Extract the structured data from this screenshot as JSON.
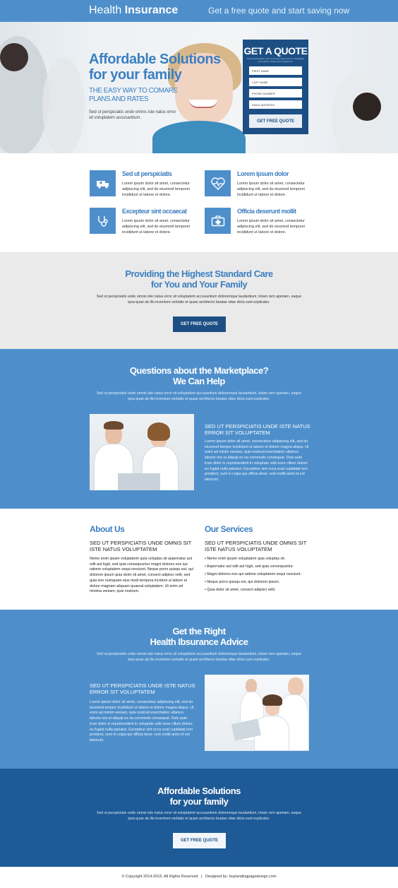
{
  "header": {
    "logo_light": "Health ",
    "logo_bold": "Insurance",
    "tagline": "Get a free quote and start saving now"
  },
  "hero": {
    "title": "Affordable Solutions for your family",
    "subtitle": "THE EASY WAY TO COMARE PLANS AND RATES",
    "description": "Sed ut perspiciatis unde omnis iste natus error sit voluptatem accusantium."
  },
  "quote_form": {
    "title": "GET A QUOTE",
    "subtitle": "Sed ut perspiciatis unde omnis iste natus error sit voluptatem accusantium doloremque laudantium",
    "first_name_placeholder": "FIRST NAME",
    "last_name_placeholder": "LAST NAME",
    "phone_placeholder": "PHONE NUMBER",
    "email_placeholder": "EMAIL ADDRESS",
    "button": "GET FREE QUOTE"
  },
  "features": [
    {
      "title": "Sed ut perspiciatis",
      "text": "Lorem ipsum dolor sit amet, consectetur adipiscing elit, sed do eiusmod temporei incididunt ut labore et dolore.",
      "icon": "ambulance-icon"
    },
    {
      "title": "Lorem ipsum dolor",
      "text": "Lorem ipsum dolor sit amet, consectetur adipiscing elit, sed do eiusmod temporei incididunt ut labore et dolore.",
      "icon": "heartbeat-icon"
    },
    {
      "title": "Excepteur sint occaecat",
      "text": "Lorem ipsum dolor sit amet, consectetur adipiscing elit, sed do eiusmod temporei incididunt ut labore et dolore.",
      "icon": "stethoscope-icon"
    },
    {
      "title": "Officia deserunt mollit",
      "text": "Lorem ipsum dolor sit amet, consectetur adipiscing elit, sed do eiusmod temporei incididunt ut labore et dolore.",
      "icon": "medical-kit-icon"
    }
  ],
  "standard_care": {
    "title_line1": "Providing the Highest Standard Care",
    "title_line2": "for You and Your Family",
    "description": "Sed ut perspiciatis unde omnis iste natus error sit voluptatem accusantium doloremque laudantium, totam rem aperiam, eaque ipsa quae ab illo inventore veritatis et quasi architecto beatae vitae dicta sunt explicabo.",
    "button": "GET FREE QUOTE"
  },
  "marketplace": {
    "title_line1": "Questions about the Marketplace?",
    "title_line2": "We Can Help",
    "description": "Sed ut perspiciatis unde omnis iste natus error sit voluptatem accusantium doloremque laudantium, totam rem aperiam, eaque ipsa quae ab illo inventore veritatis et quasi architecto beatae vitae dicta sunt explicabo.",
    "caption_title": "SED UT PERSPICIATIS UNDE ISTE NATUS ERROR SIT VOLUPTATEM",
    "caption_text": "Lorem ipsum dolor sit amet, consectetur adipiscing elit, sed do eiusmod tempor incididunt ut labore et dolore magna aliqua. Ut enim ad minim veniam, quis nostrud exercitation ullamco laboris nisi ut aliquip ex ea commodo consequat. Duis aute irure dolor in reprehenderit in voluptate velit esse cillum dolore eu fugiat nulla pariatur. Excepteur sint occa ecat cupidatat non proident, sunt in culpa qui officia dese- runt mollit anim id est laborum."
  },
  "about": {
    "title": "About Us",
    "subtitle": "SED UT PERSPICIATIS UNDE OMNIS SIT ISTE NATUS  VOLUPTATEM",
    "text": "Nemo enim ipsam voluptatem quia voluptas sit aspernatur aut odit aut fugit, sed quia consequuntur magni dolores eos qui ratione voluptatem sequi nesciunt. Neque porro quisqu est, qui dolorem ipsum quia dolor sit amet, consect adipisci velit, sed quia non numquam eius modi tempora incidunt ut labore et dolore magnam aliquam quaerat voluptatem. Ut enim ad minima veniam, quis nostrum."
  },
  "services": {
    "title": "Our Services",
    "subtitle": "SED UT PERSPICIATIS UNDE OMNIS SIT ISTE NATUS  VOLUPTATEM",
    "items": [
      "Nemo enim ipsam voluptatem quia voluptas sit.",
      "Aspernatur aut odit aut fugit, sed quia consequuntur.",
      "Magni dolores eos qui ratione voluptatem sequi nesciunt.",
      "Neque porro quisqu est, qui dolorem ipsum.",
      "Quia dolor sit amet, consect adipisci velit."
    ]
  },
  "advice": {
    "title_line1": "Get the Right",
    "title_line2": "Health Ibsurance Advice",
    "description": "Sed ut perspiciatis unde omnis iste natus error sit voluptatem accusantium doloremque laudantium, totam rem aperiam, eaque ipsa quae ab illo inventore veritatis et quasi architecto beatae vitae dicta sunt explicabo.",
    "caption_title": "SED UT PERSPICIATIS UNDE ISTE NATUS ERROR SIT VOLUPTATEM",
    "caption_text": "Lorem ipsum dolor sit amet, consectetur adipiscing elit, sed do eiusmod tempor incididunt ut labore et dolore magna aliqua. Ut enim ad minim veniam, quis nostrud exercitation ullamco laboris nisi ut aliquip ex ea commodo consequat. Duis aute irure dolor in reprehenderit in voluptate velit esse cillum dolore eu fugiat nulla pariatur. Excepteur sint occa ecat cupidatat non proident, sunt in culpa qui officia dese- runt mollit anim id est laborum."
  },
  "final_cta": {
    "title_line1": "Affordable Solutions",
    "title_line2": "for your family",
    "description": "Sed ut perspiciatis unde omnis iste natus error sit voluptatem accusantium doloremque laudantium, totam rem aperiam, eaque ipsa quae ab illo inventore veritatis et quasi architecto beatae vitae dicta sunt explicabo.",
    "button": "GET FREE QUOTE"
  },
  "footer": {
    "copyright": "© Copyright 2014-2015. All Rights Reserved",
    "separator": "|",
    "designed_by": "Designed by: buylandingpagedesign.com"
  },
  "colors": {
    "primary_blue": "#4e8fcb",
    "navy": "#1d4f85",
    "heading_blue": "#3c7fc0"
  }
}
